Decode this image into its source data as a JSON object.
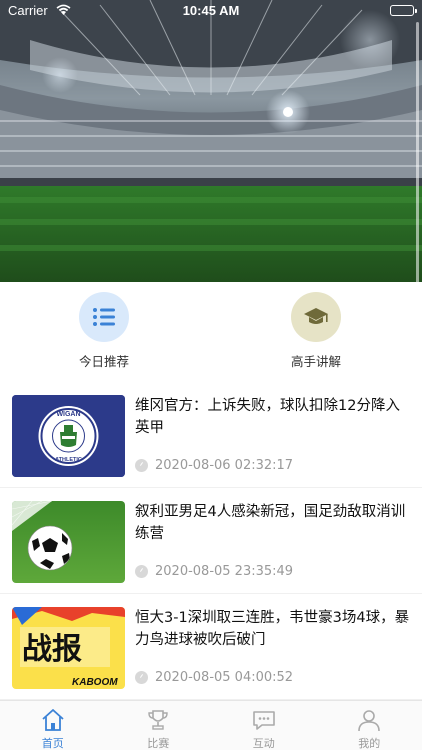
{
  "status_bar": {
    "carrier": "Carrier",
    "time": "10:45 AM"
  },
  "quick_menu": [
    {
      "label": "今日推荐",
      "icon": "list-icon",
      "color": "#3b82d6"
    },
    {
      "label": "高手讲解",
      "icon": "graduation-cap-icon",
      "color": "#6f6a3a"
    }
  ],
  "news": [
    {
      "title": "维冈官方：上诉失败，球队扣除12分降入英甲",
      "time": "2020-08-06 02:32:17",
      "thumb": "wigan-athletic-badge"
    },
    {
      "title": "叙利亚男足4人感染新冠，国足劲敌取消训练营",
      "time": "2020-08-05 23:35:49",
      "thumb": "football-on-grass"
    },
    {
      "title": "恒大3-1深圳取三连胜，韦世豪3场4球，暴力鸟进球被吹后破门",
      "time": "2020-08-05 04:00:52",
      "thumb": "zhanbao-comic"
    }
  ],
  "thumb_text": {
    "wigan_top": "WIGAN",
    "wigan_bottom": "ATHLETIC",
    "zhanbao": "战报",
    "kaboom": "KABOOM"
  },
  "tab_bar": [
    {
      "label": "首页",
      "icon": "home-icon",
      "active": true
    },
    {
      "label": "比赛",
      "icon": "trophy-icon",
      "active": false
    },
    {
      "label": "互动",
      "icon": "chat-icon",
      "active": false
    },
    {
      "label": "我的",
      "icon": "user-icon",
      "active": false
    }
  ],
  "colors": {
    "accent": "#3b82d6",
    "inactive": "#999999"
  }
}
